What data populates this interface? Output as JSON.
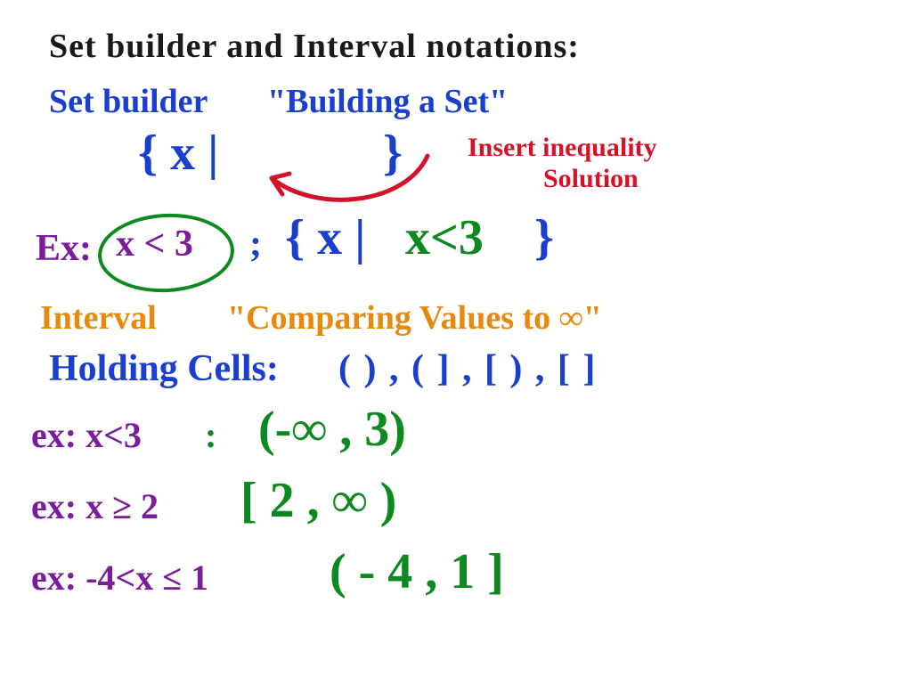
{
  "title": "Set builder and Interval notations:",
  "setbuilder": {
    "label": "Set builder",
    "quote": "\"Building a Set\"",
    "template_l": "{ x |",
    "template_r": "}",
    "insert_l1": "Insert inequality",
    "insert_l2": "Solution"
  },
  "ex_sb": {
    "ex": "Ex:",
    "cond": "x < 3",
    "sep": ";",
    "set_l": "{ x |",
    "set_cond": "x<3",
    "set_r": "}"
  },
  "interval": {
    "label": "Interval",
    "quote": "\"Comparing Values to ∞\"",
    "holding_l": "Holding Cells:",
    "holding_r": "( ) , ( ] , [ ) , [  ]"
  },
  "ex1": {
    "lhs": "ex: x<3",
    "col": ":",
    "int": "(-∞ , 3)"
  },
  "ex2": {
    "lhs": "ex: x ≥ 2",
    "int": "[ 2 , ∞ )"
  },
  "ex3": {
    "lhs": "ex: -4<x ≤ 1",
    "int": "( - 4 , 1 ]"
  }
}
